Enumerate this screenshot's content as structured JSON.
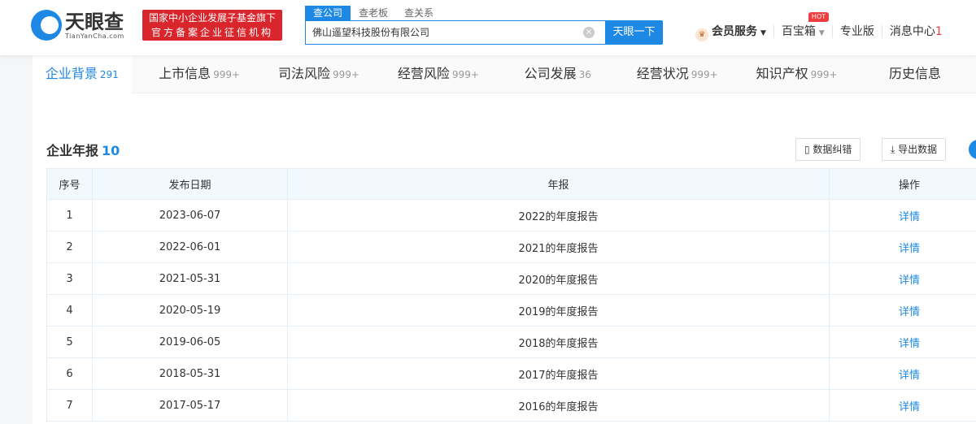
{
  "header": {
    "logo_cn": "天眼查",
    "logo_en": "TianYanCha.com",
    "slogan_1": "国家中小企业发展子基金旗下",
    "slogan_2": "官方备案企业征信机构",
    "search_tabs": [
      "查公司",
      "查老板",
      "查关系"
    ],
    "search_value": "佛山遥望科技股份有限公司",
    "search_button": "天眼一下",
    "nav": {
      "vip": "会员服务",
      "toolbox": "百宝箱",
      "hot": "HOT",
      "pro": "专业版",
      "messages": "消息中心",
      "message_count": "1"
    }
  },
  "tabs": [
    {
      "label": "企业背景",
      "count": "291"
    },
    {
      "label": "上市信息",
      "count": "999+"
    },
    {
      "label": "司法风险",
      "count": "999+"
    },
    {
      "label": "经营风险",
      "count": "999+"
    },
    {
      "label": "公司发展",
      "count": "36"
    },
    {
      "label": "经营状况",
      "count": "999+"
    },
    {
      "label": "知识产权",
      "count": "999+"
    },
    {
      "label": "历史信息",
      "count": ""
    }
  ],
  "section": {
    "title": "企业年报",
    "count": "10",
    "correct_btn": "数据纠错",
    "export_btn": "导出数据"
  },
  "table": {
    "headers": [
      "序号",
      "发布日期",
      "年报",
      "操作"
    ],
    "rows": [
      [
        "1",
        "2023-06-07",
        "2022的年度报告",
        "详情"
      ],
      [
        "2",
        "2022-06-01",
        "2021的年度报告",
        "详情"
      ],
      [
        "3",
        "2021-05-31",
        "2020的年度报告",
        "详情"
      ],
      [
        "4",
        "2020-05-19",
        "2019的年度报告",
        "详情"
      ],
      [
        "5",
        "2019-06-05",
        "2018的年度报告",
        "详情"
      ],
      [
        "6",
        "2018-05-31",
        "2017的年度报告",
        "详情"
      ],
      [
        "7",
        "2017-05-17",
        "2016的年度报告",
        "详情"
      ]
    ]
  }
}
